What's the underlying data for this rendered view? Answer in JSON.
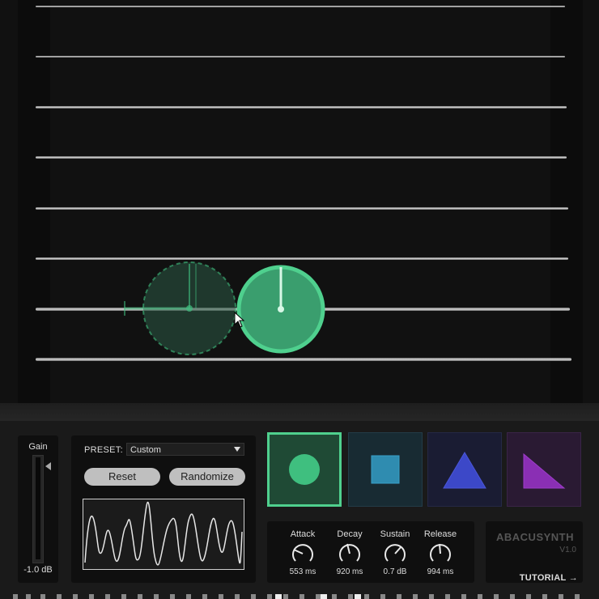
{
  "gain": {
    "label": "Gain",
    "value": "-1.0 dB"
  },
  "preset": {
    "label": "PRESET:",
    "selected": "Custom"
  },
  "buttons": {
    "reset": "Reset",
    "randomize": "Randomize"
  },
  "shapes": [
    {
      "name": "circle",
      "color": "#3fbf7f",
      "selected": true
    },
    {
      "name": "square",
      "color": "#2f8cb0",
      "selected": false
    },
    {
      "name": "triangle",
      "color": "#3c48c8",
      "selected": false
    },
    {
      "name": "right-triangle",
      "color": "#8a2fb4",
      "selected": false
    }
  ],
  "envelope": {
    "attack": {
      "label": "Attack",
      "value": "553 ms",
      "level": 0.35
    },
    "decay": {
      "label": "Decay",
      "value": "920 ms",
      "level": 0.5
    },
    "sustain": {
      "label": "Sustain",
      "value": "0.7 dB",
      "level": 0.65
    },
    "release": {
      "label": "Release",
      "value": "994 ms",
      "level": 0.52
    }
  },
  "brand": {
    "name": "ABACUSYNTH",
    "version": "V1.0",
    "tutorial": "TUTORIAL →"
  },
  "colors": {
    "accent": "#3fbf7f",
    "background": "#111111",
    "panel": "#0f0f0f"
  }
}
